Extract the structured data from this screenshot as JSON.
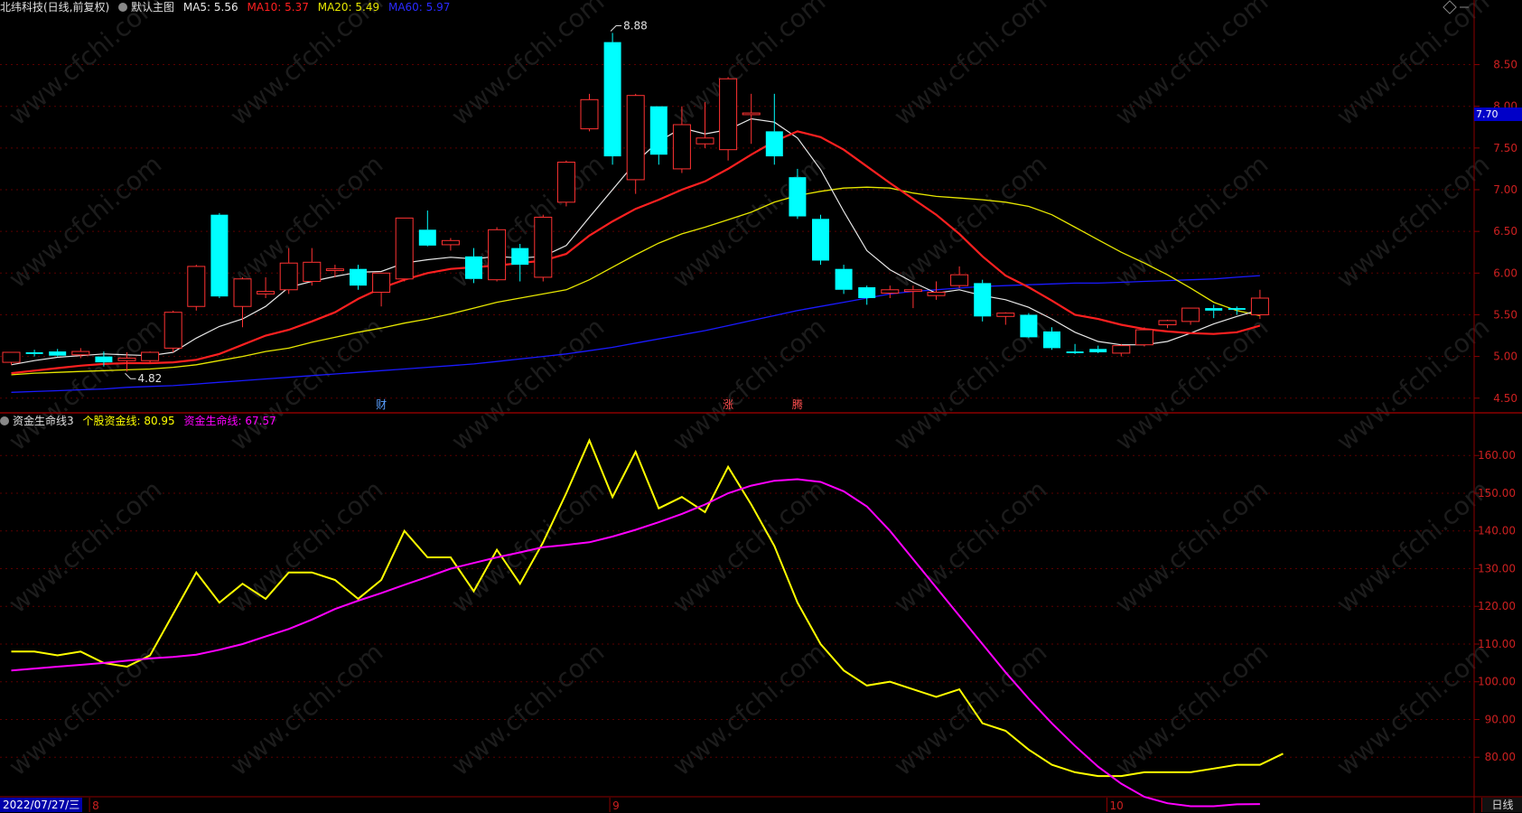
{
  "header_top": {
    "title": "北纬科技(日线,前复权)",
    "main_label": "默认主图",
    "ma5": "MA5: 5.56",
    "ma10": "MA10: 5.37",
    "ma20": "MA20: 5.49",
    "ma60": "MA60: 5.97"
  },
  "header_bottom": {
    "title": "资金生命线3",
    "line1": "个股资金线: 80.95",
    "line2": "资金生命线: 67.57"
  },
  "footer": {
    "date": "2022/07/27/三",
    "months": [
      "8",
      "9",
      "10"
    ],
    "period": "日线"
  },
  "price_marker": "7.70",
  "colors": {
    "up": "#ff3232",
    "down": "#00ffff",
    "ma5": "#e8e8e8",
    "ma10": "#ff2020",
    "ma20": "#e6e600",
    "ma60": "#1a1aff",
    "fund_line": "#ffff00",
    "life_line": "#ff00ff",
    "axis": "#8b0000"
  },
  "chart_data": [
    {
      "type": "candlestick",
      "ylim": [
        4.4,
        8.95
      ],
      "yticks": [
        4.5,
        5.0,
        5.5,
        6.0,
        6.5,
        7.0,
        7.5,
        8.0,
        8.5
      ],
      "max_label": "8.88",
      "min_label": "4.82",
      "event_labels": [
        {
          "index": 16,
          "text": "财"
        },
        {
          "index": 31,
          "text": "涨"
        },
        {
          "index": 34,
          "text": "腾"
        }
      ],
      "candles": [
        {
          "o": 4.93,
          "h": 5.05,
          "l": 4.9,
          "c": 5.05
        },
        {
          "o": 5.05,
          "h": 5.08,
          "l": 5.0,
          "c": 5.03
        },
        {
          "o": 5.06,
          "h": 5.09,
          "l": 5.0,
          "c": 5.01
        },
        {
          "o": 5.02,
          "h": 5.1,
          "l": 4.98,
          "c": 5.06
        },
        {
          "o": 5.0,
          "h": 5.06,
          "l": 4.88,
          "c": 4.93
        },
        {
          "o": 4.95,
          "h": 5.05,
          "l": 4.82,
          "c": 4.98
        },
        {
          "o": 4.95,
          "h": 5.06,
          "l": 4.93,
          "c": 5.05
        },
        {
          "o": 5.1,
          "h": 5.55,
          "l": 5.05,
          "c": 5.53
        },
        {
          "o": 5.6,
          "h": 6.1,
          "l": 5.55,
          "c": 6.08
        },
        {
          "o": 6.7,
          "h": 6.72,
          "l": 5.7,
          "c": 5.72
        },
        {
          "o": 5.6,
          "h": 5.95,
          "l": 5.35,
          "c": 5.93
        },
        {
          "o": 5.75,
          "h": 5.95,
          "l": 5.7,
          "c": 5.78
        },
        {
          "o": 5.8,
          "h": 6.3,
          "l": 5.75,
          "c": 6.12
        },
        {
          "o": 5.9,
          "h": 6.3,
          "l": 5.85,
          "c": 6.13
        },
        {
          "o": 6.03,
          "h": 6.1,
          "l": 5.95,
          "c": 6.05
        },
        {
          "o": 6.05,
          "h": 6.1,
          "l": 5.8,
          "c": 5.85
        },
        {
          "o": 5.77,
          "h": 6.0,
          "l": 5.6,
          "c": 6.0
        },
        {
          "o": 5.93,
          "h": 6.66,
          "l": 5.9,
          "c": 6.66
        },
        {
          "o": 6.52,
          "h": 6.75,
          "l": 6.32,
          "c": 6.33
        },
        {
          "o": 6.34,
          "h": 6.42,
          "l": 6.27,
          "c": 6.39
        },
        {
          "o": 6.2,
          "h": 6.3,
          "l": 5.88,
          "c": 5.93
        },
        {
          "o": 5.92,
          "h": 6.55,
          "l": 5.9,
          "c": 6.52
        },
        {
          "o": 6.3,
          "h": 6.35,
          "l": 5.9,
          "c": 6.1
        },
        {
          "o": 5.95,
          "h": 6.7,
          "l": 5.9,
          "c": 6.67
        },
        {
          "o": 6.85,
          "h": 7.35,
          "l": 6.8,
          "c": 7.33
        },
        {
          "o": 7.73,
          "h": 8.15,
          "l": 7.7,
          "c": 8.08
        },
        {
          "o": 8.77,
          "h": 8.88,
          "l": 7.3,
          "c": 7.4
        },
        {
          "o": 7.12,
          "h": 8.15,
          "l": 6.95,
          "c": 8.13
        },
        {
          "o": 8.0,
          "h": 8.0,
          "l": 7.3,
          "c": 7.42
        },
        {
          "o": 7.25,
          "h": 8.0,
          "l": 7.2,
          "c": 7.78
        },
        {
          "o": 7.55,
          "h": 8.05,
          "l": 7.5,
          "c": 7.62
        },
        {
          "o": 7.48,
          "h": 8.35,
          "l": 7.35,
          "c": 8.33
        },
        {
          "o": 7.9,
          "h": 8.15,
          "l": 7.55,
          "c": 7.92
        },
        {
          "o": 7.7,
          "h": 8.15,
          "l": 7.3,
          "c": 7.4
        },
        {
          "o": 7.15,
          "h": 7.25,
          "l": 6.65,
          "c": 6.68
        },
        {
          "o": 6.65,
          "h": 6.7,
          "l": 6.1,
          "c": 6.15
        },
        {
          "o": 6.05,
          "h": 6.1,
          "l": 5.75,
          "c": 5.8
        },
        {
          "o": 5.83,
          "h": 5.85,
          "l": 5.62,
          "c": 5.7
        },
        {
          "o": 5.76,
          "h": 5.85,
          "l": 5.7,
          "c": 5.8
        },
        {
          "o": 5.78,
          "h": 5.85,
          "l": 5.58,
          "c": 5.8
        },
        {
          "o": 5.73,
          "h": 5.9,
          "l": 5.68,
          "c": 5.77
        },
        {
          "o": 5.85,
          "h": 6.08,
          "l": 5.82,
          "c": 5.98
        },
        {
          "o": 5.88,
          "h": 5.92,
          "l": 5.42,
          "c": 5.48
        },
        {
          "o": 5.48,
          "h": 5.53,
          "l": 5.38,
          "c": 5.52
        },
        {
          "o": 5.5,
          "h": 5.52,
          "l": 5.22,
          "c": 5.23
        },
        {
          "o": 5.3,
          "h": 5.35,
          "l": 5.08,
          "c": 5.1
        },
        {
          "o": 5.06,
          "h": 5.15,
          "l": 5.03,
          "c": 5.04
        },
        {
          "o": 5.09,
          "h": 5.13,
          "l": 5.04,
          "c": 5.05
        },
        {
          "o": 5.04,
          "h": 5.15,
          "l": 5.0,
          "c": 5.13
        },
        {
          "o": 5.14,
          "h": 5.35,
          "l": 5.12,
          "c": 5.32
        },
        {
          "o": 5.38,
          "h": 5.44,
          "l": 5.34,
          "c": 5.43
        },
        {
          "o": 5.42,
          "h": 5.58,
          "l": 5.38,
          "c": 5.58
        },
        {
          "o": 5.58,
          "h": 5.62,
          "l": 5.46,
          "c": 5.55
        },
        {
          "o": 5.58,
          "h": 5.6,
          "l": 5.5,
          "c": 5.56
        },
        {
          "o": 5.5,
          "h": 5.8,
          "l": 5.45,
          "c": 5.7
        }
      ],
      "ma5": [
        4.9,
        4.95,
        4.99,
        5.01,
        5.03,
        5.02,
        5.01,
        5.05,
        5.22,
        5.36,
        5.45,
        5.6,
        5.83,
        5.9,
        5.96,
        6.01,
        6.02,
        6.12,
        6.16,
        6.19,
        6.17,
        6.2,
        6.18,
        6.2,
        6.33,
        6.67,
        7.0,
        7.33,
        7.58,
        7.74,
        7.67,
        7.72,
        7.85,
        7.81,
        7.62,
        7.24,
        6.74,
        6.27,
        6.04,
        5.89,
        5.76,
        5.8,
        5.73,
        5.68,
        5.59,
        5.45,
        5.29,
        5.18,
        5.14,
        5.14,
        5.18,
        5.28,
        5.39,
        5.48,
        5.56
      ],
      "ma10": [
        4.8,
        4.83,
        4.86,
        4.89,
        4.91,
        4.92,
        4.92,
        4.93,
        4.96,
        5.03,
        5.14,
        5.25,
        5.32,
        5.42,
        5.53,
        5.69,
        5.82,
        5.92,
        6.0,
        6.05,
        6.07,
        6.09,
        6.12,
        6.15,
        6.23,
        6.45,
        6.62,
        6.77,
        6.88,
        7.0,
        7.1,
        7.25,
        7.42,
        7.58,
        7.7,
        7.63,
        7.48,
        7.28,
        7.08,
        6.89,
        6.7,
        6.47,
        6.2,
        5.97,
        5.83,
        5.67,
        5.5,
        5.45,
        5.38,
        5.33,
        5.3,
        5.28,
        5.27,
        5.29,
        5.37
      ],
      "ma20": [
        4.78,
        4.8,
        4.81,
        4.82,
        4.83,
        4.84,
        4.85,
        4.87,
        4.9,
        4.95,
        5.0,
        5.06,
        5.1,
        5.17,
        5.23,
        5.29,
        5.34,
        5.4,
        5.45,
        5.51,
        5.58,
        5.65,
        5.7,
        5.75,
        5.8,
        5.92,
        6.07,
        6.22,
        6.36,
        6.47,
        6.55,
        6.64,
        6.73,
        6.85,
        6.93,
        6.98,
        7.02,
        7.03,
        7.02,
        6.96,
        6.92,
        6.9,
        6.88,
        6.85,
        6.8,
        6.7,
        6.55,
        6.4,
        6.25,
        6.12,
        5.98,
        5.82,
        5.65,
        5.55,
        5.49
      ],
      "ma60": [
        4.57,
        4.58,
        4.59,
        4.6,
        4.61,
        4.63,
        4.64,
        4.65,
        4.67,
        4.69,
        4.71,
        4.73,
        4.75,
        4.77,
        4.79,
        4.81,
        4.83,
        4.85,
        4.87,
        4.89,
        4.91,
        4.94,
        4.97,
        5.0,
        5.03,
        5.07,
        5.11,
        5.16,
        5.21,
        5.26,
        5.31,
        5.37,
        5.43,
        5.49,
        5.55,
        5.6,
        5.65,
        5.7,
        5.75,
        5.78,
        5.8,
        5.82,
        5.84,
        5.85,
        5.86,
        5.87,
        5.88,
        5.88,
        5.89,
        5.9,
        5.91,
        5.92,
        5.93,
        5.95,
        5.97
      ]
    },
    {
      "type": "line",
      "ylim": [
        70,
        167
      ],
      "yticks": [
        80,
        90,
        100,
        110,
        120,
        130,
        140,
        150,
        160
      ],
      "series": [
        {
          "name": "个股资金线",
          "values": [
            108,
            108,
            107,
            108,
            105,
            104,
            107,
            118,
            129,
            121,
            126,
            122,
            129,
            129,
            127,
            122,
            127,
            140,
            133,
            133,
            124,
            135,
            126,
            137,
            150,
            164,
            149,
            161,
            146,
            149,
            145,
            157,
            147,
            136,
            121,
            110,
            103,
            99,
            100,
            98,
            96,
            98,
            89,
            87,
            82,
            78,
            76,
            75,
            75,
            76,
            76,
            76,
            77,
            78,
            78,
            80.95
          ]
        },
        {
          "name": "资金生命线",
          "values": [
            103,
            103.5,
            104,
            104.5,
            105,
            105.6,
            106.2,
            106.6,
            107.2,
            108.5,
            110,
            112,
            114,
            116.5,
            119.3,
            121.5,
            123.5,
            125.7,
            127.8,
            130,
            131.5,
            133,
            134.3,
            135.7,
            136.3,
            137,
            138.5,
            140.3,
            142.3,
            144.5,
            147,
            150,
            152,
            153.3,
            153.7,
            153,
            150.5,
            146.5,
            140,
            132.5,
            125,
            117.5,
            110,
            102.5,
            95.5,
            89,
            83,
            77.5,
            73,
            69.5,
            67.8,
            67,
            67,
            67.5,
            67.57
          ]
        }
      ]
    }
  ]
}
